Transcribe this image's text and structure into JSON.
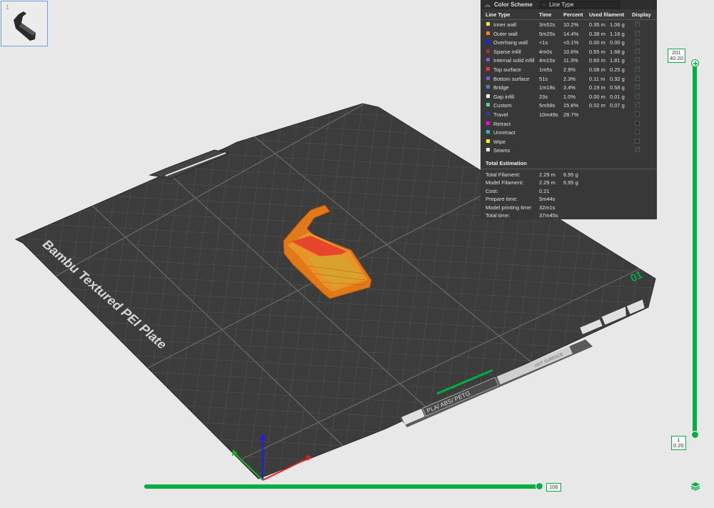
{
  "plate": {
    "thumbnail_index": "1",
    "name_label": "Bambu Textured PEI Plate",
    "plate_number": "01",
    "material_label": "PLA/ ABS/ PETG",
    "small_label": "HOT SURFACE"
  },
  "legend": {
    "header_title": "Color Scheme",
    "scheme_value": "Line Type",
    "columns": {
      "type": "Line Type",
      "time": "Time",
      "percent": "Percent",
      "filament": "Used filament",
      "display": "Display"
    },
    "rows": [
      {
        "name": "Inner wall",
        "time": "3m52s",
        "percent": "10.2%",
        "length": "0.35 m",
        "weight": "1.06 g",
        "color": "#ffe14d",
        "checked": true
      },
      {
        "name": "Outer wall",
        "time": "5m25s",
        "percent": "14.4%",
        "length": "0.38 m",
        "weight": "1.16 g",
        "color": "#ff7d38",
        "checked": true
      },
      {
        "name": "Overhang wall",
        "time": "<1s",
        "percent": "<0.1%",
        "length": "0.00 m",
        "weight": "0.00 g",
        "color": "#1f1fff",
        "checked": true
      },
      {
        "name": "Sparse infill",
        "time": "4m0s",
        "percent": "10.6%",
        "length": "0.55 m",
        "weight": "1.68 g",
        "color": "#b03029",
        "checked": true
      },
      {
        "name": "Internal solid infill",
        "time": "4m15s",
        "percent": "11.3%",
        "length": "0.60 m",
        "weight": "1.81 g",
        "color": "#9654cc",
        "checked": true
      },
      {
        "name": "Top surface",
        "time": "1m5s",
        "percent": "2.9%",
        "length": "0.08 m",
        "weight": "0.25 g",
        "color": "#ff3333",
        "checked": true
      },
      {
        "name": "Bottom surface",
        "time": "51s",
        "percent": "2.3%",
        "length": "0.11 m",
        "weight": "0.32 g",
        "color": "#7a5cc7",
        "checked": true
      },
      {
        "name": "Bridge",
        "time": "1m18s",
        "percent": "3.4%",
        "length": "0.19 m",
        "weight": "0.58 g",
        "color": "#4d80ba",
        "checked": true
      },
      {
        "name": "Gap infill",
        "time": "23s",
        "percent": "1.0%",
        "length": "0.00 m",
        "weight": "0.01 g",
        "color": "#ffffff",
        "checked": true
      },
      {
        "name": "Custom",
        "time": "5m58s",
        "percent": "15.8%",
        "length": "0.02 m",
        "weight": "0.07 g",
        "color": "#5ed194",
        "checked": true
      },
      {
        "name": "Travel",
        "time": "10m49s",
        "percent": "28.7%",
        "length": "",
        "weight": "",
        "color": "#38389e",
        "checked": false
      },
      {
        "name": "Retract",
        "time": "",
        "percent": "",
        "length": "",
        "weight": "",
        "color": "#ff00ff",
        "checked": false
      },
      {
        "name": "Unretract",
        "time": "",
        "percent": "",
        "length": "",
        "weight": "",
        "color": "#33b5cc",
        "checked": false
      },
      {
        "name": "Wipe",
        "time": "",
        "percent": "",
        "length": "",
        "weight": "",
        "color": "#ffff00",
        "checked": false
      },
      {
        "name": "Seams",
        "time": "",
        "percent": "",
        "length": "",
        "weight": "",
        "color": "#e6e6e6",
        "checked": true
      }
    ],
    "estimation_title": "Total Estimation",
    "estimation": [
      {
        "label": "Total Filament:",
        "v1": "2.29 m",
        "v2": "6.95 g"
      },
      {
        "label": "Model Filament:",
        "v1": "2.29 m",
        "v2": "6.95 g"
      },
      {
        "label": "Cost:",
        "v1": "0.21",
        "v2": ""
      },
      {
        "label": "Prepare time:",
        "v1": "5m44s",
        "v2": ""
      },
      {
        "label": "Model printing time:",
        "v1": "32m1s",
        "v2": ""
      },
      {
        "label": "Total time:",
        "v1": "37m45s",
        "v2": ""
      }
    ]
  },
  "layer_slider": {
    "top_layer": "201",
    "top_height": "40.20",
    "bottom_layer": "1",
    "bottom_height": "0.20"
  },
  "move_slider": {
    "value": "106"
  },
  "colors": {
    "accent": "#00ae42",
    "panel_bg": "#383838",
    "plate": "#3d3d3d"
  }
}
